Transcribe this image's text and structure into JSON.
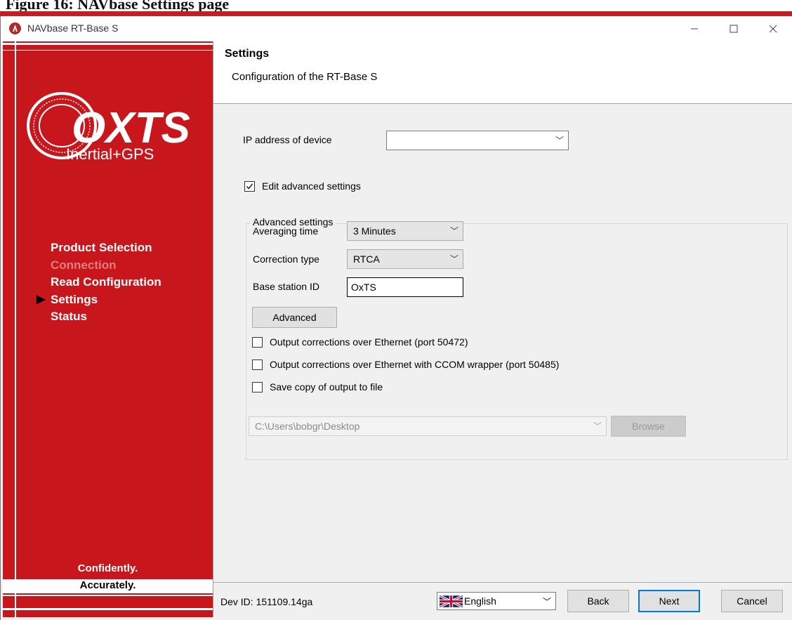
{
  "document": {
    "caption": "Figure 16: NAVbase Settings page"
  },
  "window": {
    "title": "NAVbase RT-Base S"
  },
  "sidebar": {
    "steps": [
      {
        "label": "Product Selection",
        "state": "done"
      },
      {
        "label": "Connection",
        "state": "disabled"
      },
      {
        "label": "Read Configuration",
        "state": "done"
      },
      {
        "label": "Settings",
        "state": "current"
      },
      {
        "label": "Status",
        "state": "pending"
      }
    ],
    "logo_brand": "OXTS",
    "logo_tagline": "Inertial+GPS",
    "tagline_1": "Confidently.",
    "tagline_2": "Accurately.",
    "current_marker": "▶"
  },
  "header": {
    "title": "Settings",
    "subtitle": "Configuration of the RT-Base S"
  },
  "form": {
    "ip_label": "IP address of device",
    "ip_value": "",
    "edit_advanced": {
      "label": "Edit advanced settings",
      "checked": true
    },
    "advanced_group": {
      "legend": "Advanced settings",
      "averaging_label": "Averaging time",
      "averaging_value": "3 Minutes",
      "correction_label": "Correction type",
      "correction_value": "RTCA",
      "base_id_label": "Base station ID",
      "base_id_value": "OxTS",
      "advanced_button": "Advanced",
      "out_eth": {
        "label": "Output corrections over Ethernet (port 50472)",
        "checked": false
      },
      "out_ccom": {
        "label": "Output corrections over Ethernet with CCOM wrapper (port 50485)",
        "checked": false
      },
      "save_copy": {
        "label": "Save copy of output to file",
        "checked": false
      },
      "path_value": "C:\\Users\\bobgr\\Desktop",
      "browse_button": "Browse"
    }
  },
  "footer": {
    "dev_id": "Dev ID: 151109.14ga",
    "language": "English",
    "back": "Back",
    "next": "Next",
    "cancel": "Cancel"
  },
  "colors": {
    "brand_red": "#c8161d",
    "accent_blue": "#0078d7"
  },
  "icons": [
    "oxts-app-icon",
    "minimize-icon",
    "maximize-icon",
    "close-icon",
    "chevron-down-icon",
    "checkmark-icon",
    "uk-flag-icon",
    "current-step-arrow-icon"
  ]
}
